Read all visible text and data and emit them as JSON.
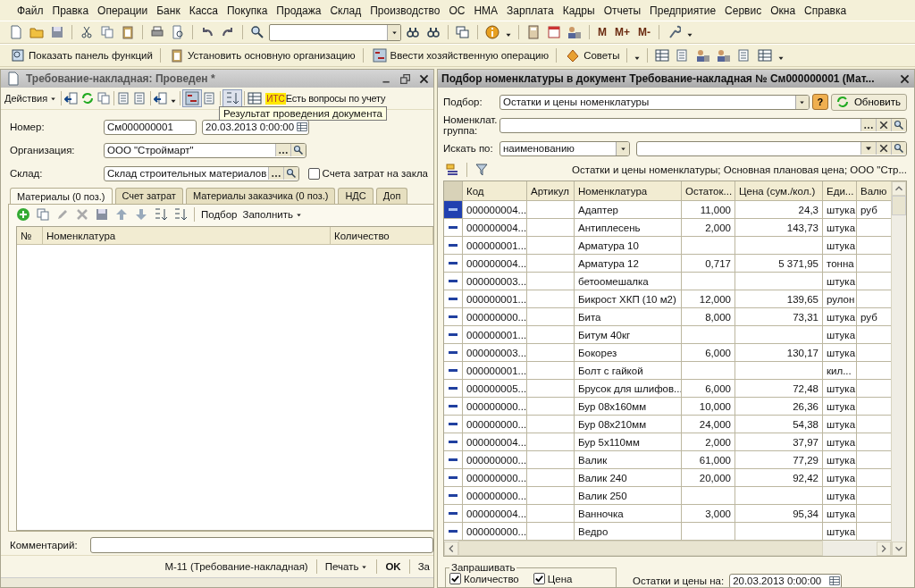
{
  "menu": [
    "Файл",
    "Правка",
    "Операции",
    "Банк",
    "Касса",
    "Покупка",
    "Продажа",
    "Склад",
    "Производство",
    "ОС",
    "НМА",
    "Зарплата",
    "Кадры",
    "Отчеты",
    "Предприятие",
    "Сервис",
    "Окна",
    "Справка"
  ],
  "toolbar": {
    "memory_buttons": [
      "M",
      "M+",
      "M-"
    ]
  },
  "toolbar2": [
    "Показать панель функций",
    "Установить основную организацию",
    "Ввести хозяйственную операцию",
    "Советы"
  ],
  "doc": {
    "title": "Требование-накладная: Проведен *",
    "actions": "Действия",
    "its_badge": "ИТС",
    "its_text": "Есть вопросы по учету",
    "tooltip": "Результат проведения документа",
    "number_label": "Номер:",
    "number": "См000000001",
    "date": "20.03.2013  0:00:00",
    "org_label": "Организация:",
    "org": "ООО \"Строймарт\"",
    "wh_label": "Склад:",
    "wh": "Склад строительных материалов",
    "cost_checkbox": {
      "label": "Счета затрат на закла",
      "checked": false
    },
    "tabs": [
      {
        "label": "Материалы (0 поз.)",
        "selected": true
      },
      {
        "label": "Счет затрат",
        "selected": false
      },
      {
        "label": "Материалы заказчика (0 поз.)",
        "selected": false
      },
      {
        "label": "НДС",
        "selected": false
      },
      {
        "label": "Доп",
        "selected": false
      }
    ],
    "table_buttons": [
      "Подбор",
      "Заполнить"
    ],
    "columns": [
      "№",
      "Номенклатура",
      "Количество"
    ],
    "comment_label": "Комментарий:",
    "footer": [
      "М-11 (Требование-накладная)",
      "Печать",
      "OK",
      "За"
    ]
  },
  "picker": {
    "title": "Подбор номенклатуры в документ Требование-накладная № См000000001 (Мат...",
    "podbor_label": "Подбор:",
    "podbor": "Остатки и цены номенклатуры",
    "help": "?",
    "refresh": "Обновить",
    "group_label": "Номенклат. группа:",
    "search_label": "Искать по:",
    "search_mode": "наименованию",
    "info": "Остатки и цены номенклатуры; Основная плановая цена; ООО \"Стр...",
    "columns": [
      "Код",
      "Артикул",
      "Номенклатура",
      "Остаток...",
      "Цена (сум./кол.)",
      "Еди...",
      "Валю"
    ],
    "rows": [
      {
        "code": "000000004...",
        "name": "Адаптер",
        "qty": "11,000",
        "price": "24,3",
        "unit": "штука",
        "cur": "руб",
        "selected": true
      },
      {
        "code": "000000004...",
        "name": "Антиплесень",
        "qty": "2,000",
        "price": "143,73",
        "unit": "штука",
        "selected": false
      },
      {
        "code": "000000001...",
        "name": "Арматура 10",
        "unit": "штука",
        "selected": false
      },
      {
        "code": "000000004...",
        "name": "Арматура 12",
        "qty": "0,717",
        "price": "5 371,95",
        "unit": "тонна",
        "selected": false
      },
      {
        "code": "000000003...",
        "name": "бетоомешалка",
        "unit": "штука",
        "selected": false
      },
      {
        "code": "000000001...",
        "name": "Бикрост ХКП (10 м2)",
        "qty": "12,000",
        "price": "139,65",
        "unit": "рулон",
        "selected": false
      },
      {
        "code": "000000000...",
        "name": "Бита",
        "qty": "8,000",
        "price": "73,31",
        "unit": "штука",
        "cur": "руб",
        "selected": false
      },
      {
        "code": "000000001...",
        "name": "Битум 40кг",
        "unit": "штука",
        "selected": false
      },
      {
        "code": "000000003...",
        "name": "Бокорез",
        "qty": "6,000",
        "price": "130,17",
        "unit": "штука",
        "selected": false
      },
      {
        "code": "000000001...",
        "name": "Болт с гайкой",
        "unit": "кил...",
        "selected": false
      },
      {
        "code": "000000005...",
        "name": "Брусок для шлифов...",
        "qty": "6,000",
        "price": "72,48",
        "unit": "штука",
        "selected": false
      },
      {
        "code": "000000000...",
        "name": "Бур 08х160мм",
        "qty": "10,000",
        "price": "26,36",
        "unit": "штука",
        "selected": false
      },
      {
        "code": "000000000...",
        "name": "Бур 08х210мм",
        "qty": "24,000",
        "price": "54,38",
        "unit": "штука",
        "selected": false
      },
      {
        "code": "000000004...",
        "name": "Бур 5х110мм",
        "qty": "2,000",
        "price": "37,97",
        "unit": "штука",
        "selected": false
      },
      {
        "code": "000000000...",
        "name": "Валик",
        "qty": "61,000",
        "price": "77,29",
        "unit": "штука",
        "selected": false
      },
      {
        "code": "000000000...",
        "name": "Валик 240",
        "qty": "20,000",
        "price": "92,42",
        "unit": "штука",
        "selected": false
      },
      {
        "code": "000000000...",
        "name": "Валик 250",
        "unit": "штука",
        "selected": false
      },
      {
        "code": "000000004...",
        "name": "Ванночка",
        "qty": "3,000",
        "price": "95,34",
        "unit": "штука",
        "selected": false
      },
      {
        "code": "000000000...",
        "name": "Ведро",
        "unit": "штука",
        "selected": false
      }
    ],
    "ask_label": "Запрашивать",
    "ask": [
      {
        "label": "Количество",
        "checked": true
      },
      {
        "label": "Цена",
        "checked": true
      }
    ],
    "date_label": "Остатки и цены на:",
    "date": "20.03.2013  0:00:00"
  }
}
